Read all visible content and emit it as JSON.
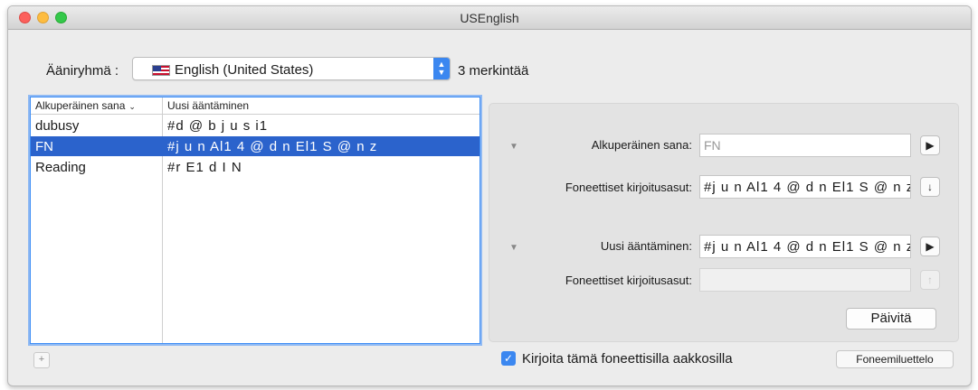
{
  "window": {
    "title": "USEnglish"
  },
  "voice": {
    "label": "Ääniryhmä :",
    "selected": "English (United States)",
    "flag_icon": "us-flag-icon",
    "entry_count": "3 merkintää"
  },
  "table": {
    "columns": [
      "Alkuperäinen sana",
      "Uusi ääntäminen"
    ],
    "sort_indicator": "⌄",
    "rows": [
      {
        "word": "dubusy",
        "pronunciation": "#d @ b j u s i1"
      },
      {
        "word": "FN",
        "pronunciation": "#j u n Al1 4 @ d n El1 S @ n z",
        "selected": true
      },
      {
        "word": "Reading",
        "pronunciation": "#r E1 d I N"
      }
    ],
    "add_label": "+"
  },
  "detail": {
    "original_label": "Alkuperäinen sana:",
    "original_value": "FN",
    "phonetic_label_1": "Foneettiset kirjoitusasut:",
    "phonetic_value_1": "#j u n Al1 4 @ d n El1 S @ n z",
    "new_label": "Uusi ääntäminen:",
    "new_value": "#j u n Al1 4 @ d n El1 S @ n z",
    "phonetic_label_2": "Foneettiset kirjoitusasut:",
    "phonetic_value_2": "",
    "update_label": "Päivitä",
    "play_glyph": "▶",
    "down_glyph": "↓",
    "up_glyph": "↑",
    "disclosure_glyph": "▼"
  },
  "footer": {
    "checkbox_label": "Kirjoita tämä foneettisilla aakkosilla",
    "checkbox_checked": true,
    "phoneme_list_label": "Foneemiluettelo"
  },
  "colors": {
    "accent": "#3b87f0",
    "selection": "#2b63cc"
  }
}
